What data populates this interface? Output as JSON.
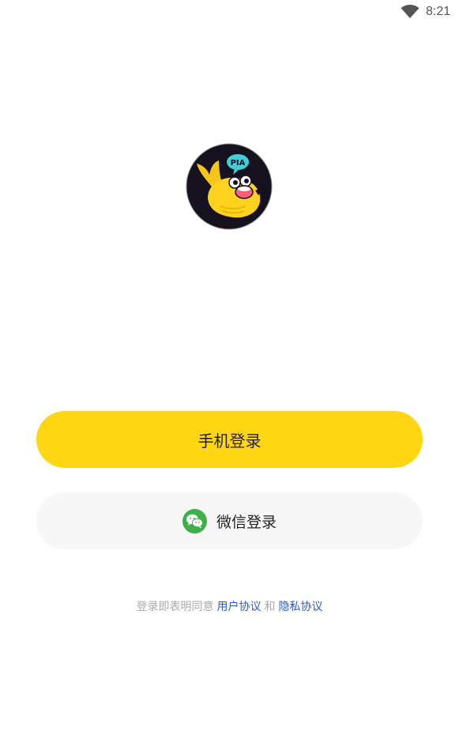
{
  "status_bar": {
    "time": "8:21",
    "wifi_icon": "wifi-icon"
  },
  "logo": {
    "icon": "app-logo-mascot",
    "badge_text": "PIA"
  },
  "buttons": {
    "phone_login": "手机登录",
    "wechat_login": "微信登录",
    "wechat_icon": "wechat-icon"
  },
  "agreement": {
    "prefix": "登录即表明同意",
    "user_agreement": "用户协议",
    "and": "和",
    "privacy_policy": "隐私协议"
  },
  "colors": {
    "accent": "#FFD612",
    "link": "#2B5BD7",
    "wechat_green": "#3EB049",
    "secondary_button_bg": "#F7F7F7",
    "hint_text": "#AAAAAA"
  }
}
